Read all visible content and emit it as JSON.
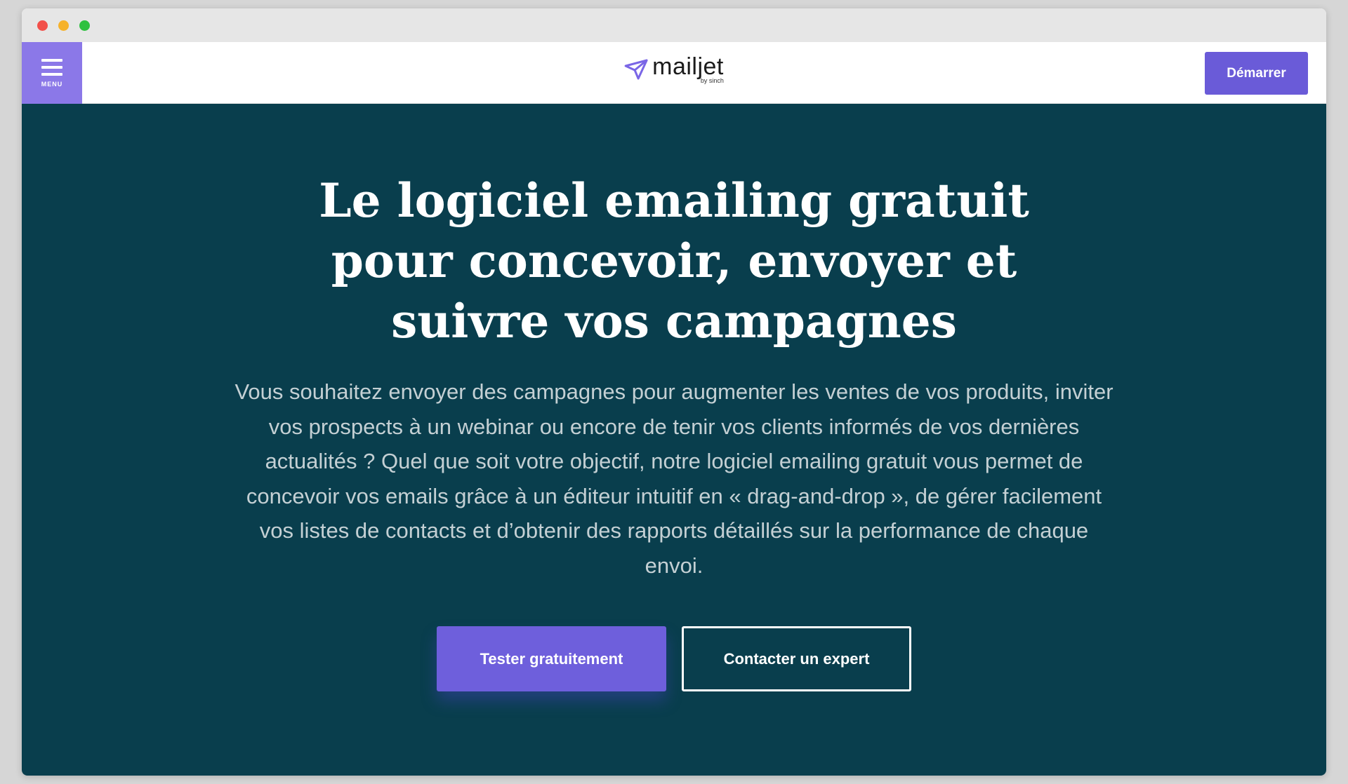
{
  "navbar": {
    "menu_label": "MENU",
    "logo_text": "mailjet",
    "logo_subtext": "by sinch",
    "start_button": "Démarrer"
  },
  "hero": {
    "title": "Le logiciel emailing gratuit pour concevoir, envoyer et suivre vos campagnes",
    "description": "Vous souhaitez envoyer des campagnes pour augmenter les ventes de vos produits, inviter vos prospects à un webinar ou encore de tenir vos clients informés de vos dernières actualités ? Quel que soit votre objectif, notre logiciel emailing gratuit vous permet de concevoir vos emails grâce à un éditeur intuitif en « drag-and-drop », de gérer facilement vos listes de contacts et d’obtenir des rapports détaillés sur la performance de chaque envoi.",
    "primary_button": "Tester gratuitement",
    "secondary_button": "Contacter un expert"
  },
  "colors": {
    "hero_background": "#093e4d",
    "accent": "#6e5fdc",
    "menu_background": "#8b78e8"
  },
  "icons": [
    "hamburger-menu-icon",
    "paper-plane-logo-icon"
  ]
}
